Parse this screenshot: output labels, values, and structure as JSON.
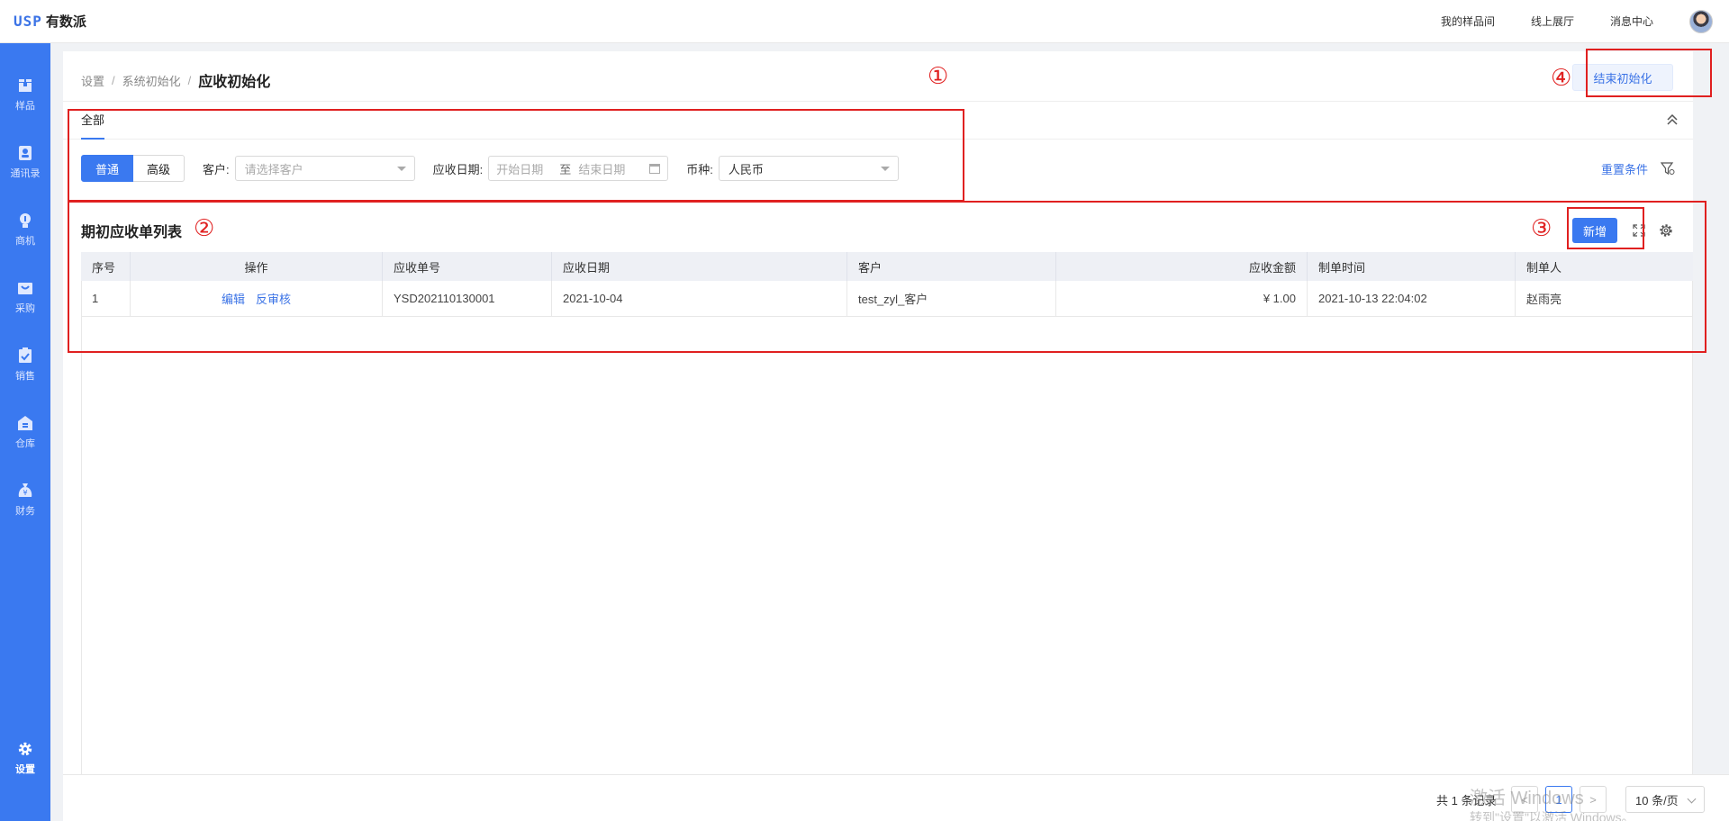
{
  "app": {
    "brand": "USP",
    "name": "有数派"
  },
  "top_links": [
    "我的样品间",
    "线上展厅",
    "消息中心"
  ],
  "sidebar": {
    "items": [
      {
        "label": "样品",
        "icon": "box-icon"
      },
      {
        "label": "通讯录",
        "icon": "contacts-icon"
      },
      {
        "label": "商机",
        "icon": "lightbulb-icon"
      },
      {
        "label": "采购",
        "icon": "cart-icon"
      },
      {
        "label": "销售",
        "icon": "clipboard-icon"
      },
      {
        "label": "仓库",
        "icon": "warehouse-icon"
      },
      {
        "label": "财务",
        "icon": "moneybag-icon"
      }
    ],
    "settings": {
      "label": "设置",
      "icon": "gear-icon"
    }
  },
  "breadcrumb": {
    "level1": "设置",
    "sep1": "/",
    "level2": "系统初始化",
    "sep2": "/",
    "current": "应收初始化"
  },
  "end_init_label": "结束初始化",
  "tabs": {
    "all": "全部"
  },
  "filters": {
    "mode_normal": "普通",
    "mode_advanced": "高级",
    "customer_label": "客户:",
    "customer_placeholder": "请选择客户",
    "date_label": "应收日期:",
    "date_start_placeholder": "开始日期",
    "date_to": "至",
    "date_end_placeholder": "结束日期",
    "currency_label": "币种:",
    "currency_value": "人民币",
    "reset_label": "重置条件"
  },
  "list": {
    "title": "期初应收单列表",
    "add_label": "新增",
    "columns": [
      "序号",
      "操作",
      "应收单号",
      "应收日期",
      "客户",
      "应收金额",
      "制单时间",
      "制单人"
    ],
    "rows": [
      {
        "index": "1",
        "edit": "编辑",
        "unaudit": "反审核",
        "number": "YSD202110130001",
        "date": "2021-10-04",
        "customer": "test_zyl_客户",
        "amount": "¥ 1.00",
        "created": "2021-10-13 22:04:02",
        "creator": "赵雨亮"
      }
    ]
  },
  "pagination": {
    "total": "共 1 条记录",
    "prev": "<",
    "current_page": "1",
    "next": ">",
    "page_size": "10 条/页"
  },
  "watermark": {
    "line1": "激活 Windows",
    "line2": "转到\"设置\"以激活 Windows。"
  },
  "annotations": [
    "①",
    "②",
    "③",
    "④"
  ],
  "colors": {
    "primary": "#3a79f0",
    "annotation": "#e02020",
    "link": "#3b73e6"
  }
}
